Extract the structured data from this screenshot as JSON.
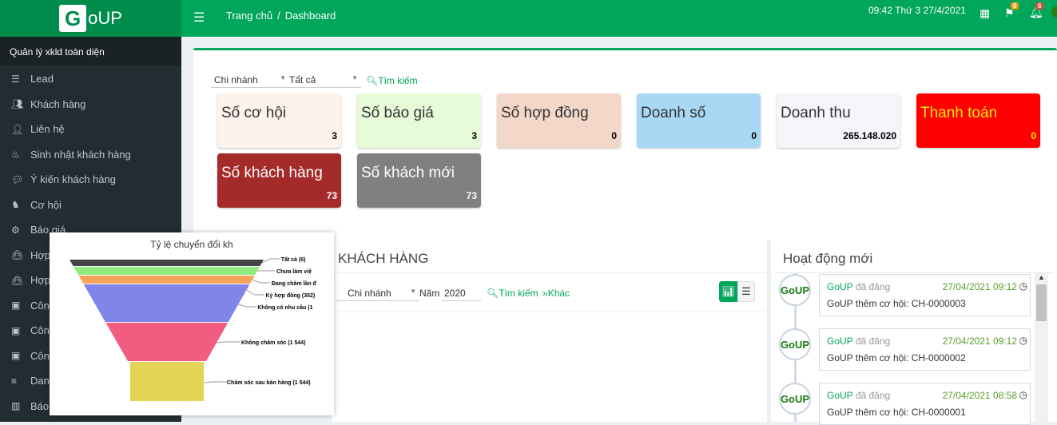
{
  "header": {
    "logo_letter": "G",
    "logo_rest": "oUP",
    "breadcrumb": [
      "Trang chủ",
      "/",
      "Dashboard"
    ],
    "clock": "09:42  Thứ 3 27/4/2021",
    "flag_badge": "0",
    "bell_badge": "6"
  },
  "sidebar": {
    "title": "Quản lý xkld toàn diện",
    "items": [
      {
        "label": "Lead",
        "icon": "database-icon"
      },
      {
        "label": "Khách hàng",
        "icon": "users-icon"
      },
      {
        "label": "Liên hệ",
        "icon": "user-icon"
      },
      {
        "label": "Sinh nhật khách hàng",
        "icon": "birthday-cake-icon"
      },
      {
        "label": "Ý kiến khách hàng",
        "icon": "comment-icon"
      },
      {
        "label": "Cơ hội",
        "icon": "opportunity-icon"
      },
      {
        "label": "Báo giá",
        "icon": "gear-icon"
      },
      {
        "label": "Hợp",
        "icon": "shopping-bag-icon"
      },
      {
        "label": "Hợp",
        "icon": "shopping-bag-icon"
      },
      {
        "label": "Công",
        "icon": "money-icon"
      },
      {
        "label": "Công",
        "icon": "money-icon"
      },
      {
        "label": "Công",
        "icon": "money-icon"
      },
      {
        "label": "Danh",
        "icon": "list-icon"
      },
      {
        "label": "Báo c",
        "icon": "bar-chart-icon"
      }
    ]
  },
  "filters": {
    "branch": "Chi nhánh",
    "all": "Tất cả",
    "search": "Tìm kiếm"
  },
  "cards": [
    {
      "label": "Số cơ hội",
      "value": "3",
      "bg": "#fdf3ec"
    },
    {
      "label": "Số báo giá",
      "value": "3",
      "bg": "#e8fbd8"
    },
    {
      "label": "Số hợp đồng",
      "value": "0",
      "bg": "#f3d7c8"
    },
    {
      "label": "Doanh số",
      "value": "0",
      "bg": "#a9d8f5"
    },
    {
      "label": "Doanh thu",
      "value": "265.148.020",
      "bg": "#f7f4fa"
    },
    {
      "label": "Thanh toán",
      "value": "0",
      "bg": "#ff0000"
    },
    {
      "label": "Số khách hàng",
      "value": "73",
      "bg": "#a52a2a"
    },
    {
      "label": "Số khách mới",
      "value": "73",
      "bg": "#808080"
    }
  ],
  "customers": {
    "title": "KHÁCH HÀNG",
    "branch": "Chi nhánh",
    "year_label": "Năm",
    "year": "2020",
    "search": "Tìm kiếm",
    "more": "Khác"
  },
  "activity": {
    "title": "Hoạt động mới",
    "entries": [
      {
        "user": "GoUP",
        "verb": "đã đăng",
        "time": "27/04/2021 09:12",
        "text": "GoUP thêm cơ hội: CH-0000003"
      },
      {
        "user": "GoUP",
        "verb": "đã đăng",
        "time": "27/04/2021 09:12",
        "text": "GoUP thêm cơ hội: CH-0000002"
      },
      {
        "user": "GoUP",
        "verb": "đã đăng",
        "time": "27/04/2021 08:58",
        "text": "GoUP thêm cơ hội: CH-0000001"
      }
    ]
  },
  "chart_data": {
    "type": "funnel",
    "title": "Tỷ lệ chuyển đổi kh",
    "stages": [
      {
        "label": "Tất cả (6)",
        "color": "#434348"
      },
      {
        "label": "Chưa làm việ",
        "color": "#90ed7d"
      },
      {
        "label": "Đang chăm lần đ",
        "color": "#f7a35c"
      },
      {
        "label": "Ký hợp đồng (352)",
        "color": "#8085e9"
      },
      {
        "label": "Không có nhu cầu (1",
        "color": "#f15c80"
      },
      {
        "label": "Không chăm sóc (1 544)",
        "color": "#f15c80"
      },
      {
        "label": "Chăm sóc sau bán hàng (1 544)",
        "color": "#e4d354"
      }
    ]
  }
}
